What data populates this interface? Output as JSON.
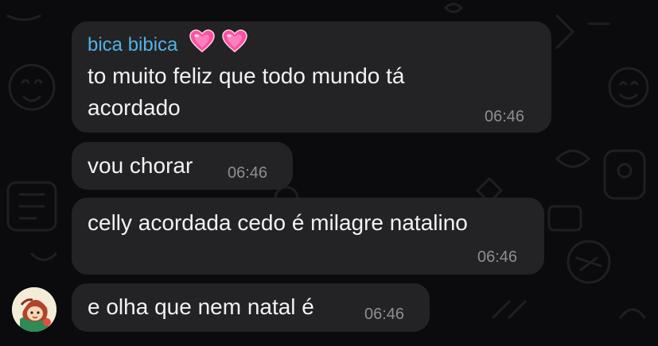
{
  "chat": {
    "messages": [
      {
        "sender": "bica bibica",
        "sender_emoji": "💗💗",
        "text_lines": [
          "to muito feliz que todo mundo tá",
          "acordado"
        ],
        "time": "06:46"
      },
      {
        "text": "vou chorar",
        "time": "06:46"
      },
      {
        "text": "celly acordada cedo é milagre natalino",
        "time": "06:46"
      },
      {
        "text": "e olha que nem natal é",
        "time": "06:46"
      }
    ]
  },
  "colors": {
    "background": "#0b0b0d",
    "bubble": "#232325",
    "sender_name": "#52b2e6",
    "timestamp": "#8e8e93",
    "heart": "#ff4fa0"
  },
  "icons": {
    "sender_badge": "sparkling-heart-icon",
    "avatar": "sender-avatar"
  }
}
